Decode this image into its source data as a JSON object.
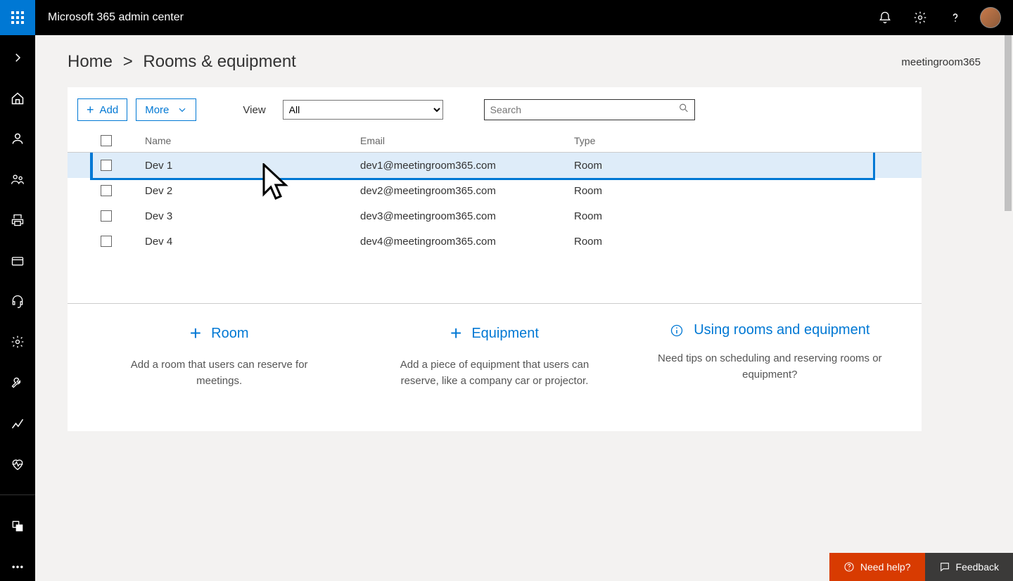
{
  "header": {
    "app_title": "Microsoft 365 admin center"
  },
  "breadcrumb": {
    "home": "Home",
    "sep": ">",
    "current": "Rooms & equipment",
    "tenant": "meetingroom365"
  },
  "toolbar": {
    "add_label": "Add",
    "more_label": "More",
    "view_label": "View",
    "view_value": "All",
    "search_placeholder": "Search"
  },
  "table": {
    "headers": {
      "name": "Name",
      "email": "Email",
      "type": "Type"
    },
    "rows": [
      {
        "name": "Dev 1",
        "email": "dev1@meetingroom365.com",
        "type": "Room",
        "selected": true
      },
      {
        "name": "Dev 2",
        "email": "dev2@meetingroom365.com",
        "type": "Room",
        "selected": false
      },
      {
        "name": "Dev 3",
        "email": "dev3@meetingroom365.com",
        "type": "Room",
        "selected": false
      },
      {
        "name": "Dev 4",
        "email": "dev4@meetingroom365.com",
        "type": "Room",
        "selected": false
      }
    ]
  },
  "cards": {
    "room": {
      "title": "Room",
      "desc": "Add a room that users can reserve for meetings."
    },
    "equipment": {
      "title": "Equipment",
      "desc": "Add a piece of equipment that users can reserve, like a company car or projector."
    },
    "using": {
      "title": "Using rooms and equipment",
      "desc": "Need tips on scheduling and reserving rooms or equipment?"
    }
  },
  "footer": {
    "need_help": "Need help?",
    "feedback": "Feedback"
  }
}
